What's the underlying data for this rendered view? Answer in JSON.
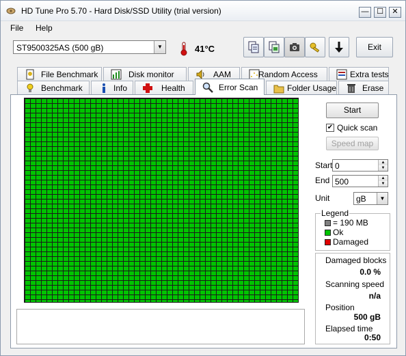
{
  "window": {
    "title": "HD Tune Pro 5.70 - Hard Disk/SSD Utility (trial version)",
    "controls": {
      "minimize": "—",
      "maximize": "☐",
      "close": "✕"
    }
  },
  "menu": {
    "file": "File",
    "help": "Help"
  },
  "toolbar": {
    "drive": "ST9500325AS (500 gB)",
    "temperature": "41°C",
    "exit_label": "Exit",
    "icons": [
      "thermometer-icon",
      "copy-text-icon",
      "copy-image-icon",
      "screenshot-icon",
      "key-icon",
      "save-down-icon"
    ]
  },
  "tabs": {
    "row1": [
      "File Benchmark",
      "Disk monitor",
      "AAM",
      "Random Access",
      "Extra tests"
    ],
    "row2": [
      "Benchmark",
      "Info",
      "Health",
      "Error Scan",
      "Folder Usage",
      "Erase"
    ],
    "active": "Error Scan"
  },
  "scan": {
    "start_label": "Start",
    "quick_scan_label": "Quick scan",
    "quick_scan_checked": true,
    "speed_map_label": "Speed map",
    "start_field_label": "Start",
    "start_value": "0",
    "end_field_label": "End",
    "end_value": "500",
    "unit_label": "Unit",
    "unit_value": "gB",
    "block_status": "ok"
  },
  "legend": {
    "title": "Legend",
    "block_size": "= 190 MB",
    "ok": "Ok",
    "damaged": "Damaged",
    "colors": {
      "block": "#808080",
      "ok": "#00c400",
      "damaged": "#e00000"
    }
  },
  "stats": {
    "damaged_blocks_label": "Damaged blocks",
    "damaged_blocks_value": "0.0 %",
    "scanning_speed_label": "Scanning speed",
    "scanning_speed_value": "n/a",
    "position_label": "Position",
    "position_value": "500 gB",
    "elapsed_label": "Elapsed time",
    "elapsed_value": "0:50"
  },
  "log": ""
}
